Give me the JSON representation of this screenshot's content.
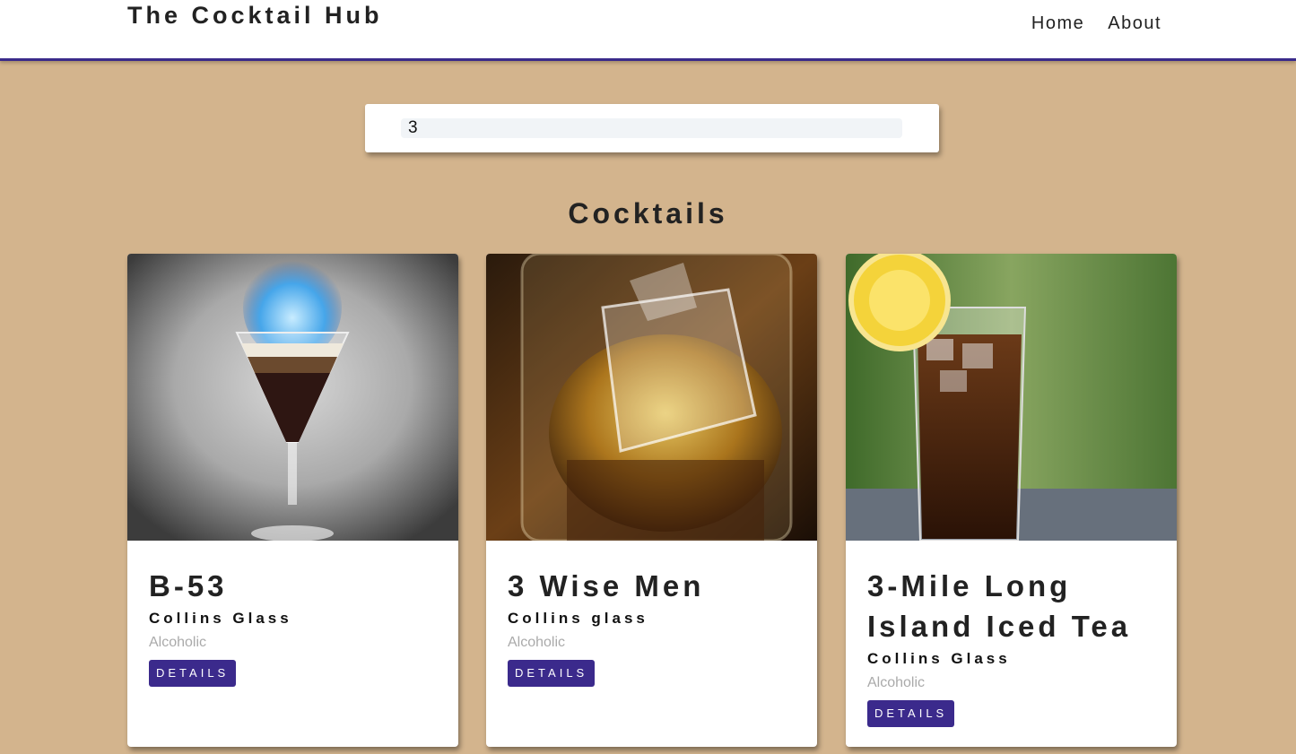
{
  "navbar": {
    "brand": "The Cocktail Hub",
    "links": [
      {
        "label": "Home"
      },
      {
        "label": "About"
      }
    ]
  },
  "search": {
    "value": "3"
  },
  "section_title": "Cocktails",
  "cocktails": [
    {
      "name": "B-53",
      "glass": "Collins Glass",
      "info": "Alcoholic",
      "button": "DETAILS",
      "image": "flaming-layered-shot-photo"
    },
    {
      "name": "3 Wise Men",
      "glass": "Collins glass",
      "info": "Alcoholic",
      "button": "DETAILS",
      "image": "whiskey-shot-splash-photo"
    },
    {
      "name": "3-Mile Long Island Iced Tea",
      "glass": "Collins Glass",
      "info": "Alcoholic",
      "button": "DETAILS",
      "image": "iced-tea-with-lemon-photo"
    }
  ],
  "colors": {
    "background": "#d3b48d",
    "accent": "#3b2a8c",
    "navbar_border": "#3a2a8a"
  }
}
